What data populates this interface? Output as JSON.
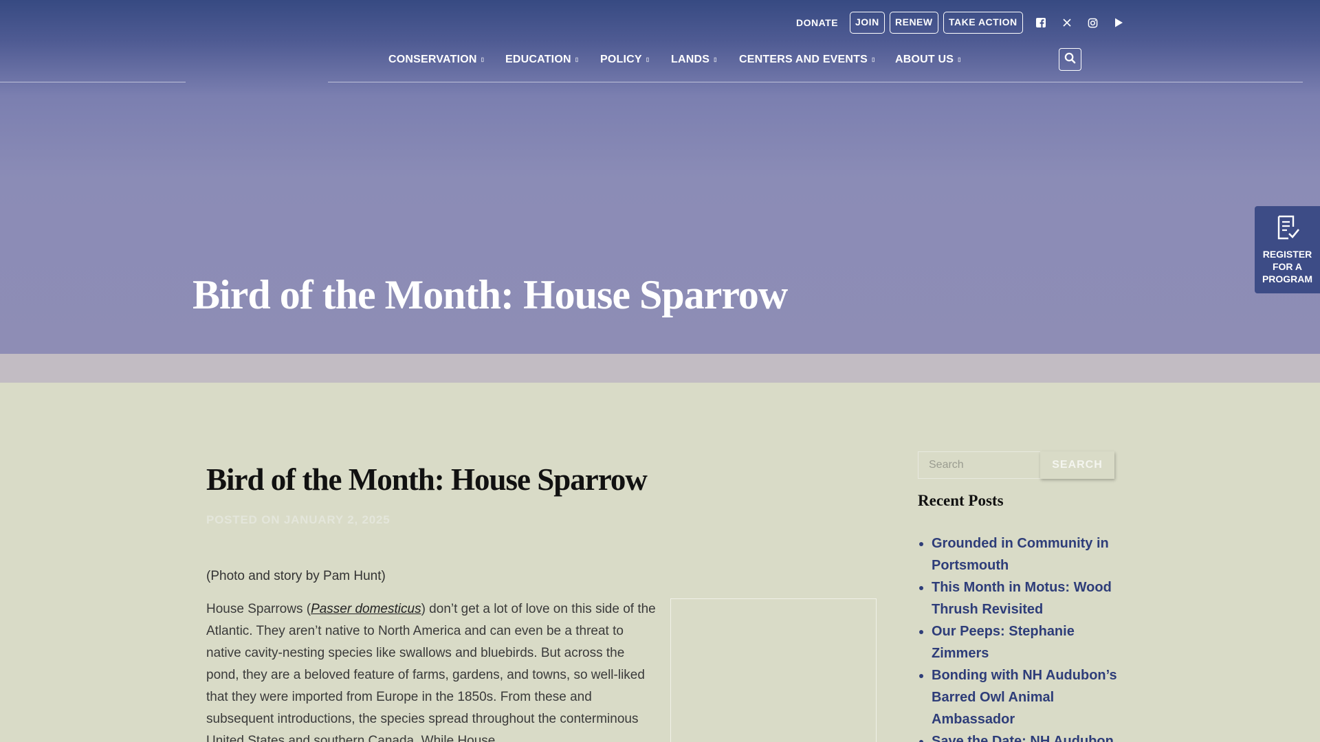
{
  "topbar": {
    "donate": "DONATE",
    "join": "JOIN",
    "renew": "RENEW",
    "take_action": "TAKE ACTION",
    "social": [
      "facebook-icon",
      "x-icon",
      "instagram-icon",
      "youtube-icon"
    ]
  },
  "nav": {
    "items": [
      {
        "label": "CONSERVATION"
      },
      {
        "label": "EDUCATION"
      },
      {
        "label": "POLICY"
      },
      {
        "label": "LANDS"
      },
      {
        "label": "CENTERS AND EVENTS"
      },
      {
        "label": "ABOUT US"
      }
    ],
    "search_icon": "search-icon"
  },
  "hero": {
    "title": "Bird of the Month: House Sparrow"
  },
  "register_tab": {
    "label_line1": "REGISTER",
    "label_line2": "FOR A",
    "label_line3": "PROGRAM"
  },
  "post": {
    "title": "Bird of the Month: House Sparrow",
    "posted": "POSTED ON JANUARY 2, 2025",
    "credit": "(Photo and story by Pam Hunt)",
    "body_before": "House Sparrows (",
    "latin_name": "Passer domesticus",
    "body_after": ") don’t get a lot of love on this side of the Atlantic. They aren’t native to North America and can even be a threat to native cavity-nesting species like swallows and bluebirds. But across the pond, they are a beloved feature of farms, gardens, and towns, so well-liked that they were imported from Europe in the 1850s. From these and subsequent introductions, the species spread throughout the conterminous United States and southern Canada. While House"
  },
  "sidebar": {
    "search_placeholder": "Search",
    "search_button": "SEARCH",
    "recent_title": "Recent Posts",
    "recent_posts": [
      "Grounded in Community in Portsmouth",
      "This Month in Motus: Wood Thrush Revisited",
      "Our Peeps: Stephanie Zimmers",
      "Bonding with NH Audubon’s Barred Owl Animal Ambassador",
      "Save the Date: NH Audubon"
    ]
  },
  "colors": {
    "header_dark": "#374a82",
    "hero_lavender": "#8e8db5",
    "stripe": "#c2bcc3",
    "page_bg": "#d9dbc7",
    "link_blue": "#2e3d79",
    "register_tab": "#3d4c86"
  }
}
